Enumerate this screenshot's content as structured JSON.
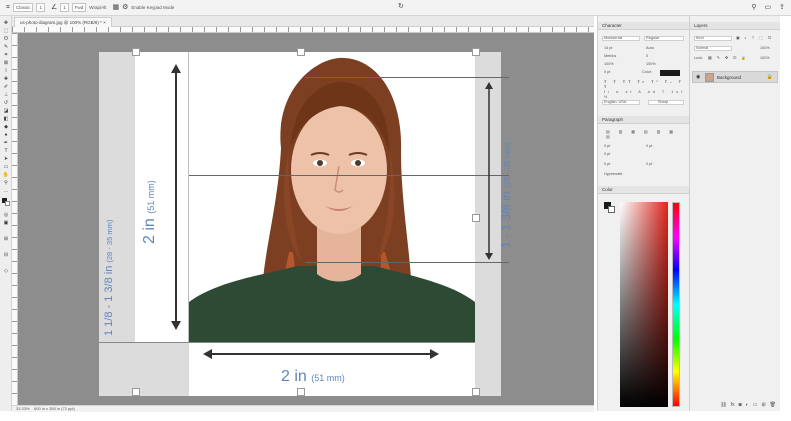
{
  "options_bar": {
    "mode_value": "Classic",
    "width_value": "1",
    "first_button": "Fwd",
    "second_label": "Wrap/Alt",
    "third_label": "Enable Keypad Mode"
  },
  "document_tab": {
    "title": "us-photo-diagram.jpg @ 100% (RGB/8) *"
  },
  "canvas": {
    "dim_bottom_big": "2 in",
    "dim_bottom_small": "(51 mm)",
    "dim_left_big": "2 in",
    "dim_left_small": "(51 mm)",
    "dim_right_big": "1 - 1 3/8 in",
    "dim_right_small": "(25 - 35 mm)",
    "dim_farleft_big": "1 1/8 - 1 3/8 in",
    "dim_farleft_small": "(28 - 35 mm)"
  },
  "status_bar": {
    "zoom": "33.33%",
    "doc_size": "600 in x 350 in (72 ppi)"
  },
  "panels": {
    "character_title": "Character",
    "paragraph_title": "Paragraph",
    "color_title": "Color",
    "layers_title": "Layers",
    "font_family": "Montserrat",
    "font_style": "Regular",
    "font_size": "14 pt",
    "leading": "Auto",
    "kerning": "Metrics",
    "tracking": "0",
    "vscale": "100%",
    "hscale": "100%",
    "baseline": "0 pt",
    "color_label": "Color:",
    "language": "English: USA",
    "aa_mode": "Sharp",
    "indent_left": "0 pt",
    "indent_right": "0 pt",
    "indent_first": "0 pt",
    "space_before": "0 pt",
    "space_after": "0 pt",
    "hyphenate": "Hyphenate",
    "layers_kind": "Kind",
    "layers_blend": "Normal",
    "layers_opacity": "100%",
    "layers_lock": "Lock:",
    "layers_fill": "100%",
    "layer_name": "Background"
  }
}
